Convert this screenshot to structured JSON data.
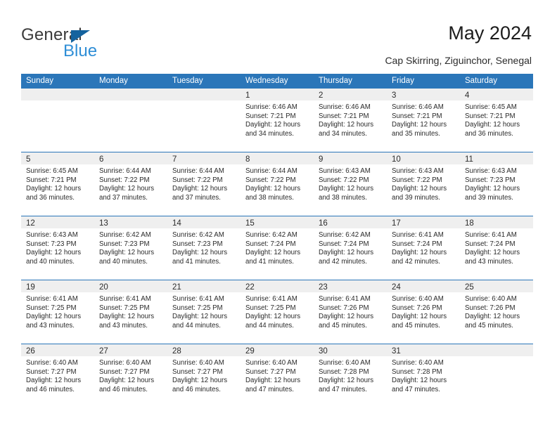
{
  "brand": {
    "name_top": "General",
    "name_bottom": "Blue",
    "accent_color": "#2f8ed6",
    "triangle_color": "#14639e",
    "triangle_icon": "triangle-icon"
  },
  "header": {
    "title": "May 2024",
    "subtitle": "Cap Skirring, Ziguinchor, Senegal"
  },
  "calendar": {
    "header_bg": "#2b76b9",
    "daycell_head_bg": "#efefef",
    "weekdays": [
      "Sunday",
      "Monday",
      "Tuesday",
      "Wednesday",
      "Thursday",
      "Friday",
      "Saturday"
    ],
    "weeks": [
      [
        {
          "day": "",
          "lines": []
        },
        {
          "day": "",
          "lines": []
        },
        {
          "day": "",
          "lines": []
        },
        {
          "day": "1",
          "lines": [
            "Sunrise: 6:46 AM",
            "Sunset: 7:21 PM",
            "Daylight: 12 hours",
            "and 34 minutes."
          ]
        },
        {
          "day": "2",
          "lines": [
            "Sunrise: 6:46 AM",
            "Sunset: 7:21 PM",
            "Daylight: 12 hours",
            "and 34 minutes."
          ]
        },
        {
          "day": "3",
          "lines": [
            "Sunrise: 6:46 AM",
            "Sunset: 7:21 PM",
            "Daylight: 12 hours",
            "and 35 minutes."
          ]
        },
        {
          "day": "4",
          "lines": [
            "Sunrise: 6:45 AM",
            "Sunset: 7:21 PM",
            "Daylight: 12 hours",
            "and 36 minutes."
          ]
        }
      ],
      [
        {
          "day": "5",
          "lines": [
            "Sunrise: 6:45 AM",
            "Sunset: 7:21 PM",
            "Daylight: 12 hours",
            "and 36 minutes."
          ]
        },
        {
          "day": "6",
          "lines": [
            "Sunrise: 6:44 AM",
            "Sunset: 7:22 PM",
            "Daylight: 12 hours",
            "and 37 minutes."
          ]
        },
        {
          "day": "7",
          "lines": [
            "Sunrise: 6:44 AM",
            "Sunset: 7:22 PM",
            "Daylight: 12 hours",
            "and 37 minutes."
          ]
        },
        {
          "day": "8",
          "lines": [
            "Sunrise: 6:44 AM",
            "Sunset: 7:22 PM",
            "Daylight: 12 hours",
            "and 38 minutes."
          ]
        },
        {
          "day": "9",
          "lines": [
            "Sunrise: 6:43 AM",
            "Sunset: 7:22 PM",
            "Daylight: 12 hours",
            "and 38 minutes."
          ]
        },
        {
          "day": "10",
          "lines": [
            "Sunrise: 6:43 AM",
            "Sunset: 7:22 PM",
            "Daylight: 12 hours",
            "and 39 minutes."
          ]
        },
        {
          "day": "11",
          "lines": [
            "Sunrise: 6:43 AM",
            "Sunset: 7:23 PM",
            "Daylight: 12 hours",
            "and 39 minutes."
          ]
        }
      ],
      [
        {
          "day": "12",
          "lines": [
            "Sunrise: 6:43 AM",
            "Sunset: 7:23 PM",
            "Daylight: 12 hours",
            "and 40 minutes."
          ]
        },
        {
          "day": "13",
          "lines": [
            "Sunrise: 6:42 AM",
            "Sunset: 7:23 PM",
            "Daylight: 12 hours",
            "and 40 minutes."
          ]
        },
        {
          "day": "14",
          "lines": [
            "Sunrise: 6:42 AM",
            "Sunset: 7:23 PM",
            "Daylight: 12 hours",
            "and 41 minutes."
          ]
        },
        {
          "day": "15",
          "lines": [
            "Sunrise: 6:42 AM",
            "Sunset: 7:24 PM",
            "Daylight: 12 hours",
            "and 41 minutes."
          ]
        },
        {
          "day": "16",
          "lines": [
            "Sunrise: 6:42 AM",
            "Sunset: 7:24 PM",
            "Daylight: 12 hours",
            "and 42 minutes."
          ]
        },
        {
          "day": "17",
          "lines": [
            "Sunrise: 6:41 AM",
            "Sunset: 7:24 PM",
            "Daylight: 12 hours",
            "and 42 minutes."
          ]
        },
        {
          "day": "18",
          "lines": [
            "Sunrise: 6:41 AM",
            "Sunset: 7:24 PM",
            "Daylight: 12 hours",
            "and 43 minutes."
          ]
        }
      ],
      [
        {
          "day": "19",
          "lines": [
            "Sunrise: 6:41 AM",
            "Sunset: 7:25 PM",
            "Daylight: 12 hours",
            "and 43 minutes."
          ]
        },
        {
          "day": "20",
          "lines": [
            "Sunrise: 6:41 AM",
            "Sunset: 7:25 PM",
            "Daylight: 12 hours",
            "and 43 minutes."
          ]
        },
        {
          "day": "21",
          "lines": [
            "Sunrise: 6:41 AM",
            "Sunset: 7:25 PM",
            "Daylight: 12 hours",
            "and 44 minutes."
          ]
        },
        {
          "day": "22",
          "lines": [
            "Sunrise: 6:41 AM",
            "Sunset: 7:25 PM",
            "Daylight: 12 hours",
            "and 44 minutes."
          ]
        },
        {
          "day": "23",
          "lines": [
            "Sunrise: 6:41 AM",
            "Sunset: 7:26 PM",
            "Daylight: 12 hours",
            "and 45 minutes."
          ]
        },
        {
          "day": "24",
          "lines": [
            "Sunrise: 6:40 AM",
            "Sunset: 7:26 PM",
            "Daylight: 12 hours",
            "and 45 minutes."
          ]
        },
        {
          "day": "25",
          "lines": [
            "Sunrise: 6:40 AM",
            "Sunset: 7:26 PM",
            "Daylight: 12 hours",
            "and 45 minutes."
          ]
        }
      ],
      [
        {
          "day": "26",
          "lines": [
            "Sunrise: 6:40 AM",
            "Sunset: 7:27 PM",
            "Daylight: 12 hours",
            "and 46 minutes."
          ]
        },
        {
          "day": "27",
          "lines": [
            "Sunrise: 6:40 AM",
            "Sunset: 7:27 PM",
            "Daylight: 12 hours",
            "and 46 minutes."
          ]
        },
        {
          "day": "28",
          "lines": [
            "Sunrise: 6:40 AM",
            "Sunset: 7:27 PM",
            "Daylight: 12 hours",
            "and 46 minutes."
          ]
        },
        {
          "day": "29",
          "lines": [
            "Sunrise: 6:40 AM",
            "Sunset: 7:27 PM",
            "Daylight: 12 hours",
            "and 47 minutes."
          ]
        },
        {
          "day": "30",
          "lines": [
            "Sunrise: 6:40 AM",
            "Sunset: 7:28 PM",
            "Daylight: 12 hours",
            "and 47 minutes."
          ]
        },
        {
          "day": "31",
          "lines": [
            "Sunrise: 6:40 AM",
            "Sunset: 7:28 PM",
            "Daylight: 12 hours",
            "and 47 minutes."
          ]
        },
        {
          "day": "",
          "lines": []
        }
      ]
    ]
  }
}
